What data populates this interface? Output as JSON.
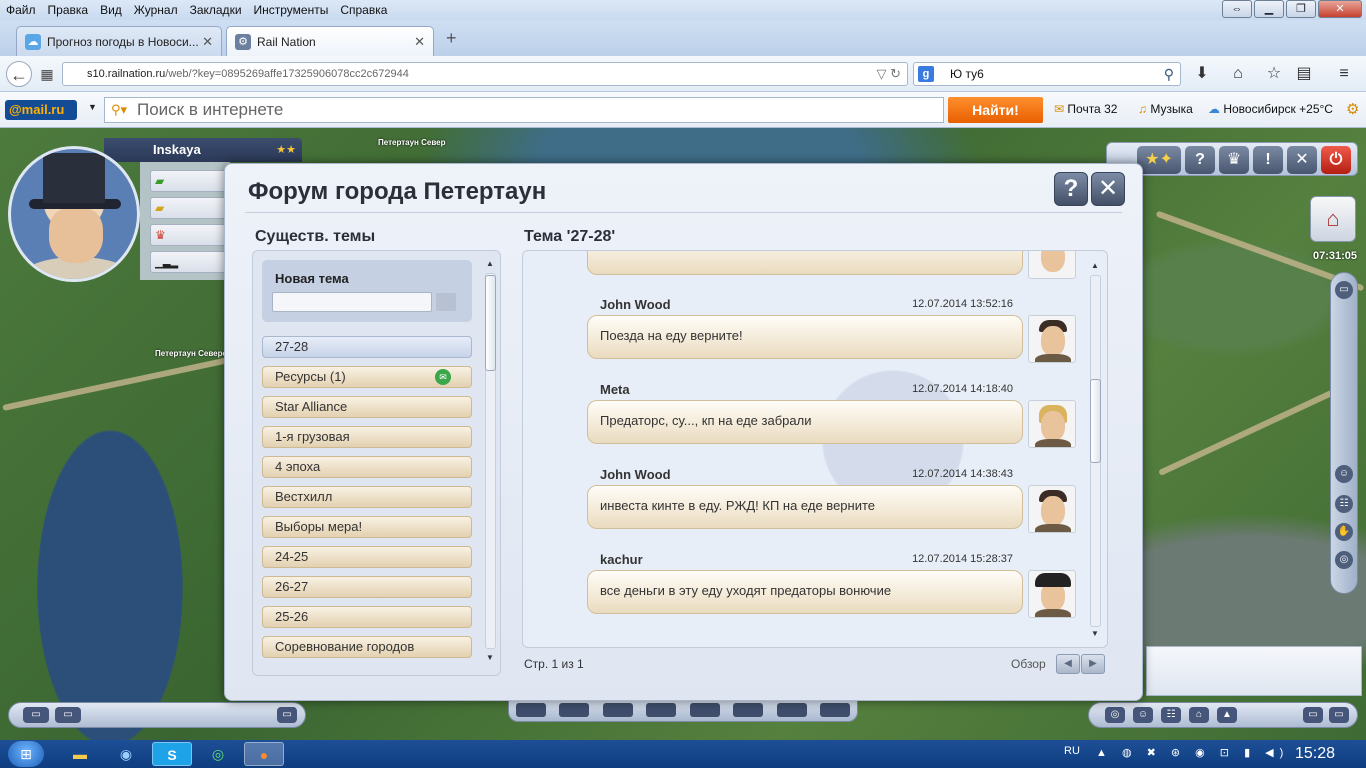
{
  "browser": {
    "menu": [
      "Файл",
      "Правка",
      "Вид",
      "Журнал",
      "Закладки",
      "Инструменты",
      "Справка"
    ],
    "tabs": [
      {
        "title": "Прогноз погоды в Новоси...",
        "active": false
      },
      {
        "title": "Rail Nation",
        "active": true
      }
    ],
    "url_host": "s10.railnation.ru",
    "url_path": "/web/?key=0895269affe17325906078cc2c672944",
    "search_text": "Ю ту6"
  },
  "mailbar": {
    "logo": "@mail.ru",
    "search_placeholder": "Поиск в интернете",
    "find_button": "Найти!",
    "mail": "Почта 32",
    "music": "Музыка",
    "weather": "Новосибирск +25°С"
  },
  "game": {
    "player_name": "Inskaya",
    "map_label_1": "Петертаун Север",
    "map_label_2": "Петертаун Северо-",
    "clock": "07:31:05"
  },
  "forum": {
    "title": "Форум города Петертаун",
    "topics_heading": "Существ. темы",
    "new_topic_label": "Новая тема",
    "topics": [
      {
        "title": "27-28",
        "selected": true,
        "has_mail": false
      },
      {
        "title": "Ресурсы (1)",
        "selected": false,
        "has_mail": true
      },
      {
        "title": "Star Alliance",
        "selected": false,
        "has_mail": false
      },
      {
        "title": "1-я грузовая",
        "selected": false,
        "has_mail": false
      },
      {
        "title": "4 эпоха",
        "selected": false,
        "has_mail": false
      },
      {
        "title": "Вестхилл",
        "selected": false,
        "has_mail": false
      },
      {
        "title": "Выборы мера!",
        "selected": false,
        "has_mail": false
      },
      {
        "title": "24-25",
        "selected": false,
        "has_mail": false
      },
      {
        "title": "26-27",
        "selected": false,
        "has_mail": false
      },
      {
        "title": "25-26",
        "selected": false,
        "has_mail": false
      },
      {
        "title": "Соревнование городов",
        "selected": false,
        "has_mail": false
      }
    ],
    "thread_heading": "Тема '27-28'",
    "messages": [
      {
        "author": "John Wood",
        "time": "12.07.2014 13:52:16",
        "text": "Поезда на еду верните!",
        "avatar": "man"
      },
      {
        "author": "Meta",
        "time": "12.07.2014 14:18:40",
        "text": "Предаторс, су..., кп на еде забрали",
        "avatar": "blonde"
      },
      {
        "author": "John Wood",
        "time": "12.07.2014 14:38:43",
        "text": "инвеста кинте в еду. РЖД! КП на еде верните",
        "avatar": "man"
      },
      {
        "author": "kachur",
        "time": "12.07.2014 15:28:37",
        "text": "все деньги в эту еду уходят предаторы вонючие",
        "avatar": "hat"
      }
    ],
    "pager": "Стр. 1 из 1",
    "browse_label": "Обзор"
  },
  "taskbar": {
    "lang": "RU",
    "clock": "15:28"
  }
}
